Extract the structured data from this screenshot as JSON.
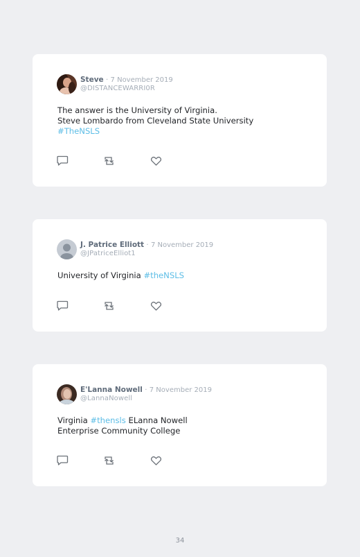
{
  "tweets": [
    {
      "author": "Steve",
      "separator": "·",
      "date": "7 November 2019",
      "handle": "@DISTANCEWARRI0R",
      "lines": [
        [
          {
            "text": "The answer is the University of Virginia."
          }
        ],
        [
          {
            "text": "Steve Lombardo from Cleveland State University"
          }
        ],
        [
          {
            "text": "#TheNSLS",
            "hashtag": true
          }
        ]
      ]
    },
    {
      "author": "J. Patrice Elliott",
      "separator": "·",
      "date": "7 November 2019",
      "handle": "@JPatriceElliot1",
      "lines": [
        [
          {
            "text": "University of Virginia "
          },
          {
            "text": "#theNSLS",
            "hashtag": true
          }
        ]
      ]
    },
    {
      "author": "E'Lanna Nowell",
      "separator": "·",
      "date": "7 November 2019",
      "handle": "@LannaNowell",
      "lines": [
        [
          {
            "text": "Virginia "
          },
          {
            "text": "#thensls",
            "hashtag": true
          },
          {
            "text": " ELanna Nowell"
          }
        ],
        [
          {
            "text": "Enterprise Community College"
          }
        ]
      ]
    }
  ],
  "icons": {
    "reply": "reply-icon",
    "retweet": "retweet-icon",
    "like": "heart-icon"
  },
  "colors": {
    "background": "#eeeff2",
    "card": "#ffffff",
    "hashtag": "#5cbde6",
    "meta": "#a5adb7",
    "author": "#5f6b7a"
  },
  "page_number": "34"
}
